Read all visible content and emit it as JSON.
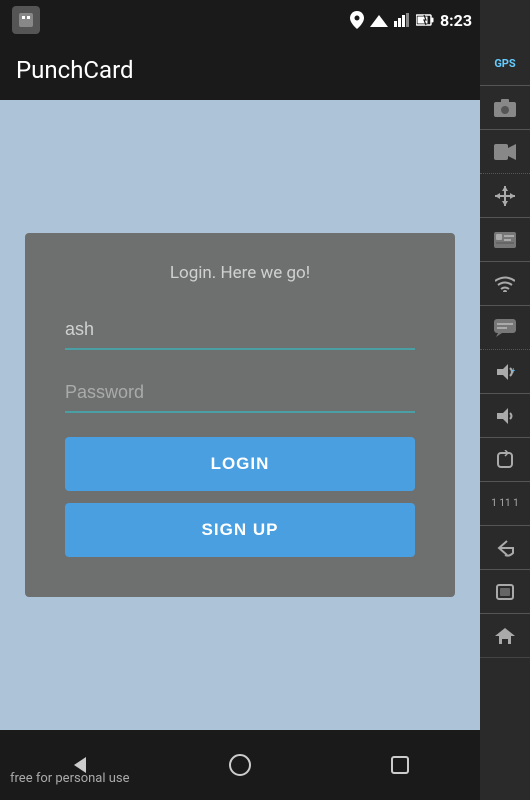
{
  "statusBar": {
    "time": "8:23",
    "icons": [
      "location",
      "signal",
      "battery"
    ]
  },
  "appHeader": {
    "title": "PunchCard"
  },
  "loginCard": {
    "subtitle": "Login. Here we go!",
    "usernamePlaceholder": "ash",
    "passwordPlaceholder": "Password",
    "loginButton": "LOGIN",
    "signupButton": "SIGN UP"
  },
  "navBar": {
    "bottomText": "free for personal use",
    "icons": [
      "back",
      "home",
      "recents"
    ]
  },
  "sidebar": {
    "icons": [
      "gps",
      "camera",
      "video",
      "move",
      "id",
      "wifi",
      "chat",
      "volume-up",
      "volume-down",
      "rotate",
      "number",
      "back",
      "recents",
      "home"
    ]
  }
}
